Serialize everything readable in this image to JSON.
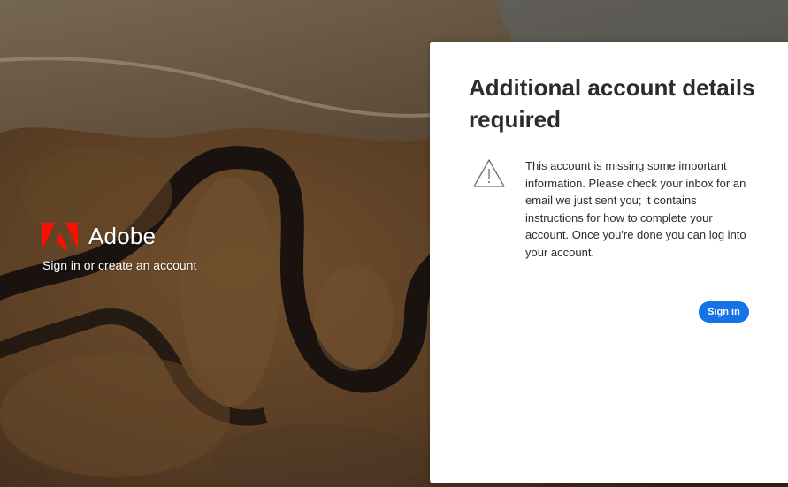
{
  "brand": {
    "name": "Adobe",
    "tagline": "Sign in or create an account",
    "logo_icon": "adobe-logo-icon",
    "logo_color": "#fa0f00"
  },
  "dialog": {
    "title": "Additional account details required",
    "alert_icon": "warning-triangle-icon",
    "message": "This account is missing some important information. Please check your inbox for an email we just sent you; it contains instructions for how to complete your account. Once you're done you can log into your account.",
    "signin_label": "Sign in",
    "button_color": "#1473e6"
  }
}
